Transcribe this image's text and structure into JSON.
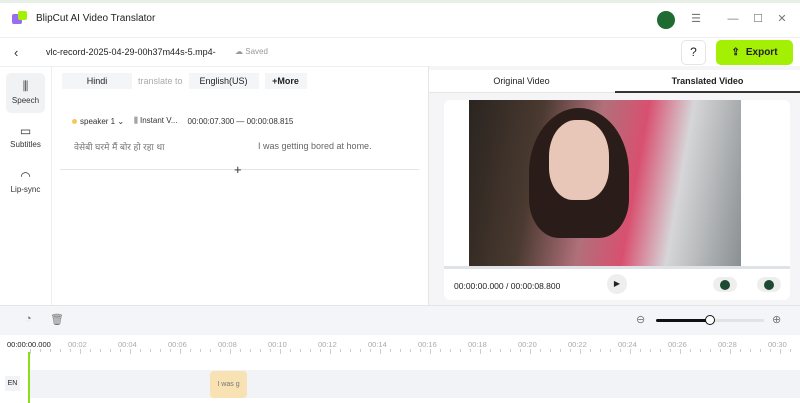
{
  "app": {
    "title": "BlipCut AI Video Translator"
  },
  "header": {
    "filename": "vlc-record-2025-04-29-00h37m44s-5.mp4-",
    "saved": "Saved",
    "help": "?",
    "export": "Export"
  },
  "sidebar": {
    "items": [
      {
        "label": "Speech",
        "icon": "waveform-icon"
      },
      {
        "label": "Subtitles",
        "icon": "subtitles-icon"
      },
      {
        "label": "Lip-sync",
        "icon": "lips-icon"
      }
    ]
  },
  "langbar": {
    "source": "Hindi",
    "translate_to": "translate to",
    "target": "English(US)",
    "more": "+More"
  },
  "segment": {
    "speaker": "speaker 1",
    "voice": "Instant V...",
    "range": "00:00:07.300 — 00:00:08.815",
    "source_text": "वेसेबी घरमे मैं बोर हो रहा था",
    "translated_text": "I was getting bored at home."
  },
  "preview": {
    "tabs": [
      "Original Video",
      "Translated Video"
    ],
    "active_tab": 1,
    "time": "00:00:00.000 / 00:00:08.800"
  },
  "timeline": {
    "start": "00:00:00.000",
    "labels": [
      "00:02",
      "00:04",
      "00:06",
      "00:08",
      "00:10",
      "00:12",
      "00:14",
      "00:16",
      "00:18",
      "00:20",
      "00:22",
      "00:24",
      "00:26",
      "00:28",
      "00:30"
    ],
    "zoom_level": 0.5,
    "track_label": "EN",
    "clip_text": "I was g"
  },
  "colors": {
    "accent": "#a3f005",
    "playhead": "#8fdc1a",
    "clip": "#f8e2b4"
  }
}
